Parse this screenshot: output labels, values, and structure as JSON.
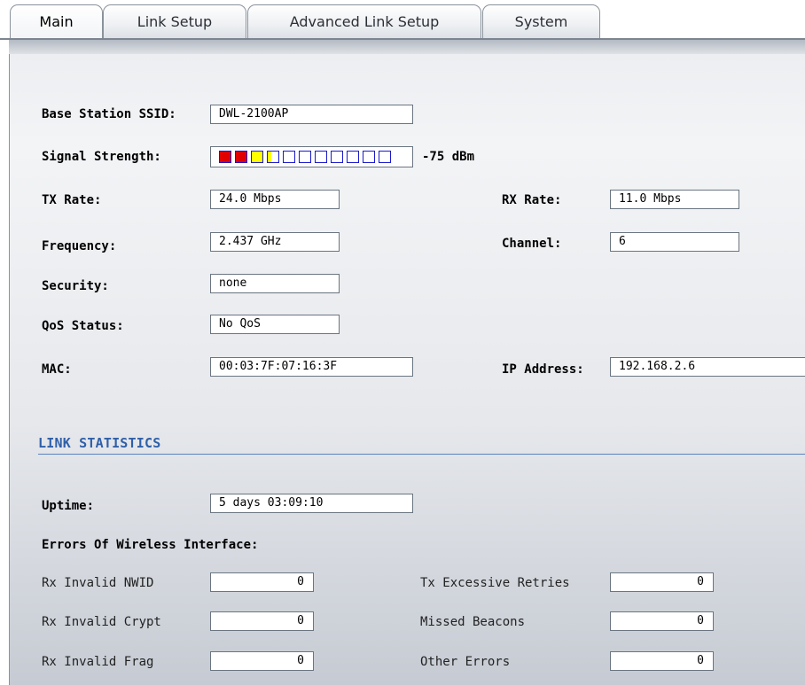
{
  "tabs": [
    {
      "label": "Main",
      "active": true
    },
    {
      "label": "Link Setup",
      "active": false
    },
    {
      "label": "Advanced Link Setup",
      "active": false
    },
    {
      "label": "System",
      "active": false
    }
  ],
  "status": {
    "ssid": {
      "label": "Base Station SSID:",
      "value": "DWL-2100AP"
    },
    "signal": {
      "label": "Signal Strength:",
      "value": "-75 dBm",
      "bars_total": 11,
      "bars": [
        "red",
        "red",
        "yellow",
        "half-yellow",
        "empty",
        "empty",
        "empty",
        "empty",
        "empty",
        "empty",
        "empty"
      ]
    },
    "tx_rate": {
      "label": "TX Rate:",
      "value": "24.0 Mbps"
    },
    "rx_rate": {
      "label": "RX Rate:",
      "value": "11.0 Mbps"
    },
    "frequency": {
      "label": "Frequency:",
      "value": "2.437 GHz"
    },
    "channel": {
      "label": "Channel:",
      "value": "6"
    },
    "security": {
      "label": "Security:",
      "value": "none"
    },
    "qos": {
      "label": "QoS Status:",
      "value": "No QoS"
    },
    "mac": {
      "label": "MAC:",
      "value": "00:03:7F:07:16:3F"
    },
    "ip": {
      "label": "IP Address:",
      "value": "192.168.2.6"
    }
  },
  "link_statistics": {
    "title": "LINK STATISTICS",
    "uptime": {
      "label": "Uptime:",
      "value": "5 days 03:09:10"
    },
    "errors_heading": "Errors Of Wireless Interface:",
    "errors": {
      "rx_invalid_nwid": {
        "label": "Rx Invalid NWID",
        "value": "0"
      },
      "tx_excessive_retries": {
        "label": "Tx Excessive Retries",
        "value": "0"
      },
      "rx_invalid_crypt": {
        "label": "Rx Invalid Crypt",
        "value": "0"
      },
      "missed_beacons": {
        "label": "Missed Beacons",
        "value": "0"
      },
      "rx_invalid_frag": {
        "label": "Rx Invalid Frag",
        "value": "0"
      },
      "other_errors": {
        "label": "Other Errors",
        "value": "0"
      }
    }
  },
  "colors": {
    "section_title": "#2f5fa8",
    "bar_red": "#e10000",
    "bar_yellow": "#ffff00",
    "bar_border": "#1a1acc"
  }
}
